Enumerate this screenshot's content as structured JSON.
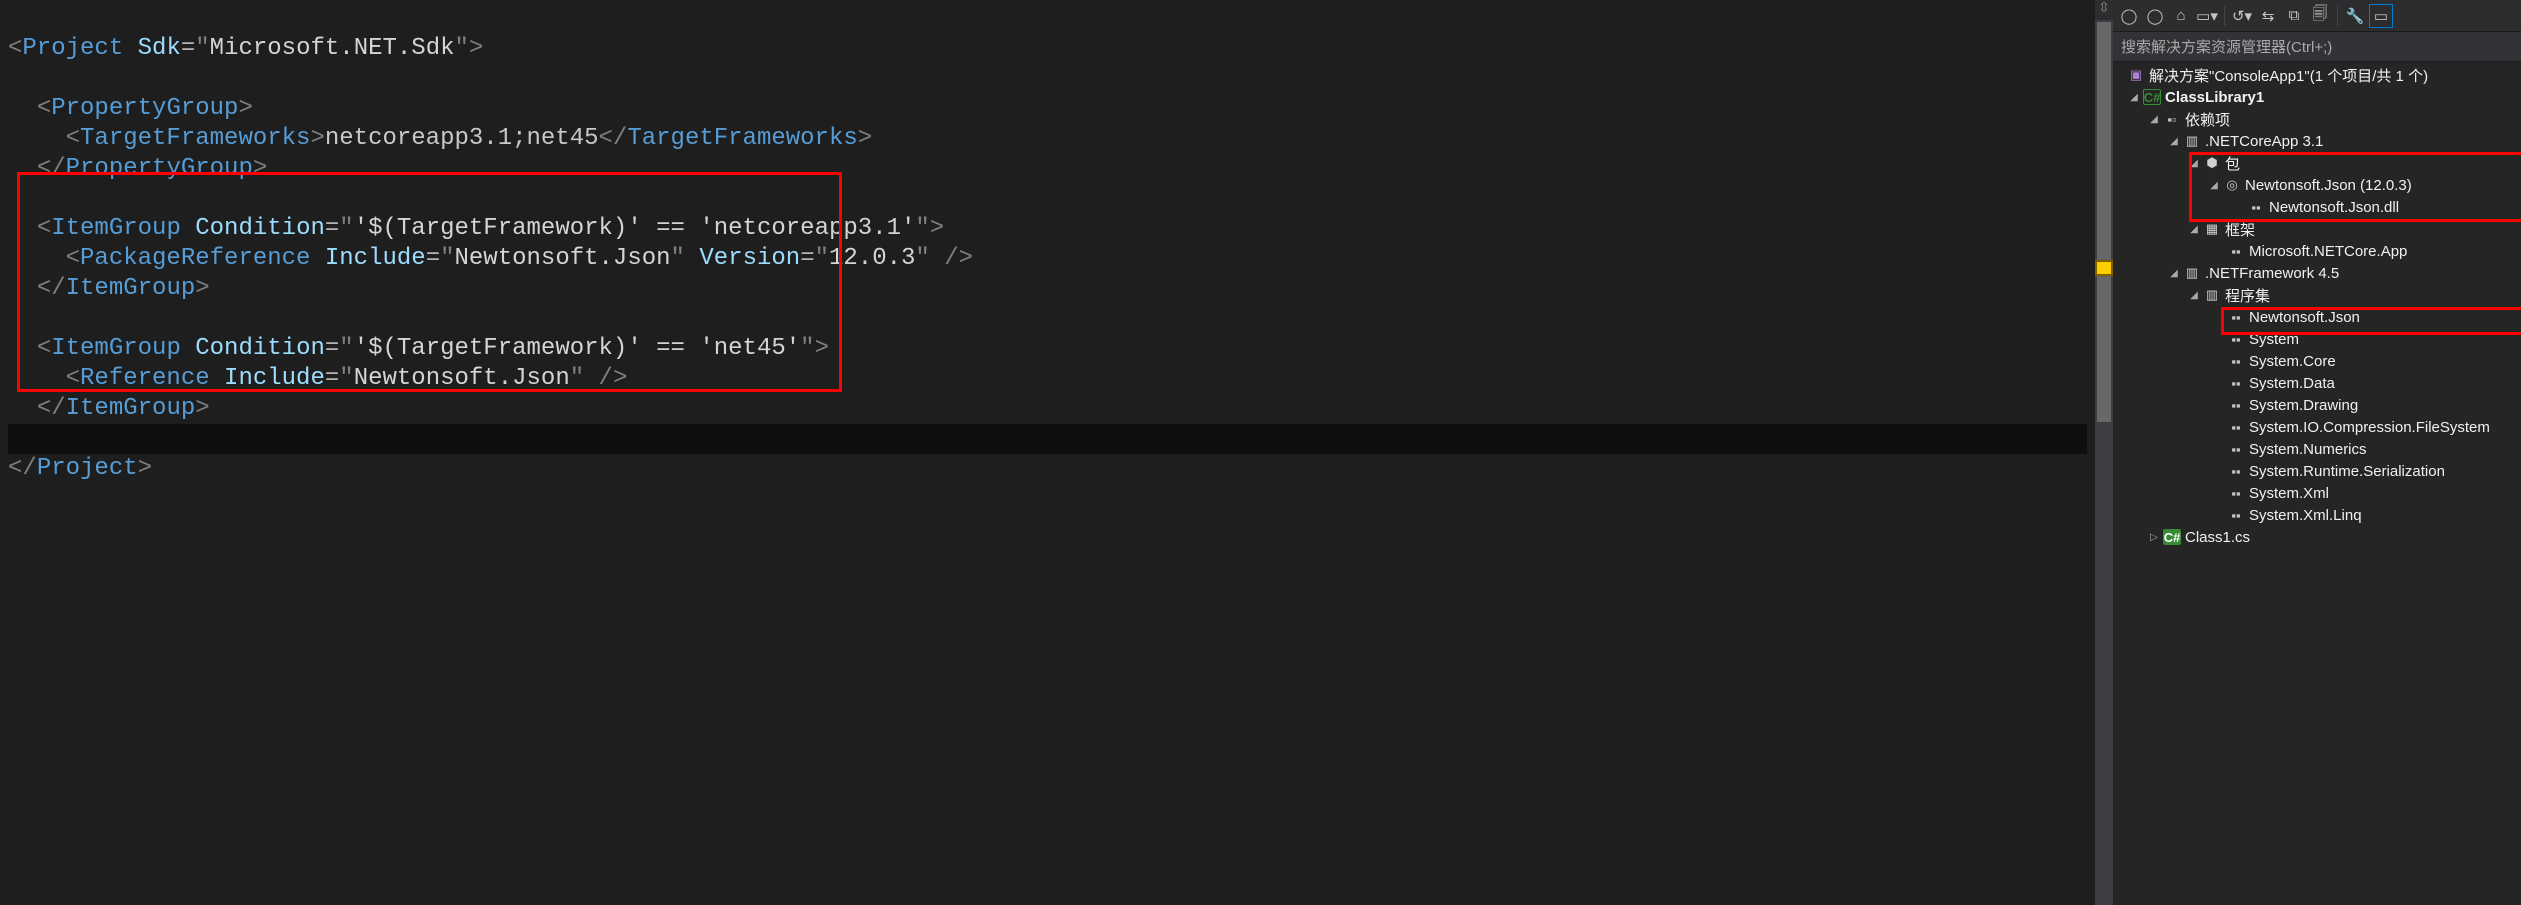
{
  "editor": {
    "l1_open": "<",
    "l1_tag": "Project",
    "l1_sp": " ",
    "l1_attr": "Sdk",
    "l1_eq": "=",
    "l1_q1": "\"",
    "l1_val": "Microsoft.NET.Sdk",
    "l1_q2": "\"",
    "l1_close": ">",
    "l3_open": "<",
    "l3_tag": "PropertyGroup",
    "l3_close": ">",
    "l4_open": "<",
    "l4_tag": "TargetFrameworks",
    "l4_close": ">",
    "l4_txt": "netcoreapp3.1;net45",
    "l4_open2": "</",
    "l4_tag2": "TargetFrameworks",
    "l4_close2": ">",
    "l5_open": "</",
    "l5_tag": "PropertyGroup",
    "l5_close": ">",
    "l7_open": "<",
    "l7_tag": "ItemGroup",
    "l7_sp": " ",
    "l7_attr": "Condition",
    "l7_eq": "=",
    "l7_q1": "\"",
    "l7_val": "'$(TargetFramework)' == 'netcoreapp3.1'",
    "l7_q2": "\"",
    "l7_close": ">",
    "l8_open": "<",
    "l8_tag": "PackageReference",
    "l8_sp": " ",
    "l8_attr1": "Include",
    "l8_eq1": "=",
    "l8_q1a": "\"",
    "l8_val1": "Newtonsoft.Json",
    "l8_q1b": "\"",
    "l8_sp2": " ",
    "l8_attr2": "Version",
    "l8_eq2": "=",
    "l8_q2a": "\"",
    "l8_val2": "12.0.3",
    "l8_q2b": "\"",
    "l8_close": " />",
    "l9_open": "</",
    "l9_tag": "ItemGroup",
    "l9_close": ">",
    "l11_open": "<",
    "l11_tag": "ItemGroup",
    "l11_sp": " ",
    "l11_attr": "Condition",
    "l11_eq": "=",
    "l11_q1": "\"",
    "l11_val": "'$(TargetFramework)' == 'net45'",
    "l11_q2": "\"",
    "l11_close": ">",
    "l12_open": "<",
    "l12_tag": "Reference",
    "l12_sp": " ",
    "l12_attr": "Include",
    "l12_eq": "=",
    "l12_q1": "\"",
    "l12_val": "Newtonsoft.Json",
    "l12_q2": "\"",
    "l12_close": " />",
    "l13_open": "</",
    "l13_tag": "ItemGroup",
    "l13_close": ">",
    "l15_open": "</",
    "l15_tag": "Project",
    "l15_close": ">"
  },
  "explorer": {
    "search_placeholder": "搜索解决方案资源管理器(Ctrl+;)",
    "solution": "解决方案\"ConsoleApp1\"(1 个项目/共 1 个)",
    "project": "ClassLibrary1",
    "dependencies": "依赖项",
    "netcoreapp": ".NETCoreApp 3.1",
    "pkg_group": "包",
    "newtonsoft_pkg": "Newtonsoft.Json (12.0.3)",
    "newtonsoft_dll": "Newtonsoft.Json.dll",
    "framework_group": "框架",
    "netcore_app": "Microsoft.NETCore.App",
    "netfw": ".NETFramework 4.5",
    "assemblies": "程序集",
    "refs": [
      "Newtonsoft.Json",
      "System",
      "System.Core",
      "System.Data",
      "System.Drawing",
      "System.IO.Compression.FileSystem",
      "System.Numerics",
      "System.Runtime.Serialization",
      "System.Xml",
      "System.Xml.Linq"
    ],
    "class1": "Class1.cs"
  }
}
